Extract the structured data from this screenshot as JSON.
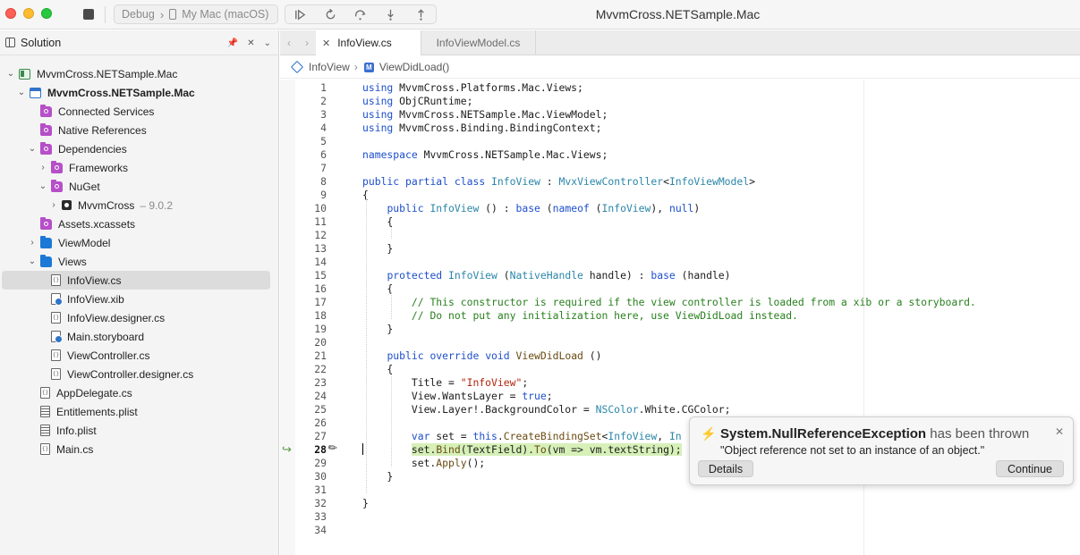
{
  "window": {
    "title": "MvvmCross.NETSample.Mac",
    "run_configuration": "Debug",
    "run_target": "My Mac (macOS)"
  },
  "toolbar": {
    "buttons": [
      "stop",
      "continue-debug",
      "restart",
      "step-over",
      "step-into",
      "step-out"
    ]
  },
  "sidebar": {
    "title": "Solution",
    "items": [
      {
        "label": "MvvmCross.NETSample.Mac",
        "icon": "solution-icon",
        "depth": 0,
        "expanded": true
      },
      {
        "label": "MvvmCross.NETSample.Mac",
        "icon": "project-icon",
        "depth": 1,
        "expanded": true,
        "bold": true
      },
      {
        "label": "Connected Services",
        "icon": "folder-purple-icon",
        "depth": 2
      },
      {
        "label": "Native References",
        "icon": "folder-purple-icon",
        "depth": 2
      },
      {
        "label": "Dependencies",
        "icon": "folder-purple-icon",
        "depth": 2,
        "expanded": true
      },
      {
        "label": "Frameworks",
        "icon": "folder-purple-icon",
        "depth": 3,
        "expanded": false
      },
      {
        "label": "NuGet",
        "icon": "folder-purple-icon",
        "depth": 3,
        "expanded": true
      },
      {
        "label": "MvvmCross",
        "version": "– 9.0.2",
        "icon": "package-icon",
        "depth": 4,
        "expanded": false
      },
      {
        "label": "Assets.xcassets",
        "icon": "folder-purple-icon",
        "depth": 2
      },
      {
        "label": "ViewModel",
        "icon": "folder-blue-icon",
        "depth": 2,
        "expanded": false
      },
      {
        "label": "Views",
        "icon": "folder-blue-icon",
        "depth": 2,
        "expanded": true
      },
      {
        "label": "InfoView.cs",
        "icon": "csharp-file-icon",
        "depth": 3,
        "selected": true
      },
      {
        "label": "InfoView.xib",
        "icon": "xib-file-icon",
        "depth": 3
      },
      {
        "label": "InfoView.designer.cs",
        "icon": "csharp-file-icon",
        "depth": 3
      },
      {
        "label": "Main.storyboard",
        "icon": "xib-file-icon",
        "depth": 3
      },
      {
        "label": "ViewController.cs",
        "icon": "csharp-file-icon",
        "depth": 3
      },
      {
        "label": "ViewController.designer.cs",
        "icon": "csharp-file-icon",
        "depth": 3
      },
      {
        "label": "AppDelegate.cs",
        "icon": "csharp-file-icon",
        "depth": 2
      },
      {
        "label": "Entitlements.plist",
        "icon": "plist-file-icon",
        "depth": 2
      },
      {
        "label": "Info.plist",
        "icon": "plist-file-icon",
        "depth": 2
      },
      {
        "label": "Main.cs",
        "icon": "csharp-file-icon",
        "depth": 2
      }
    ]
  },
  "tabs": [
    {
      "label": "InfoView.cs",
      "active": true
    },
    {
      "label": "InfoViewModel.cs",
      "active": false
    }
  ],
  "breadcrumb": {
    "class_name": "InfoView",
    "separator": "›",
    "method_name": "ViewDidLoad()"
  },
  "editor": {
    "current_line": 28,
    "lines": [
      "using MvvmCross.Platforms.Mac.Views;",
      "using ObjCRuntime;",
      "using MvvmCross.NETSample.Mac.ViewModel;",
      "using MvvmCross.Binding.BindingContext;",
      "",
      "namespace MvvmCross.NETSample.Mac.Views;",
      "",
      "public partial class InfoView : MvxViewController<InfoViewModel>",
      "{",
      "    public InfoView () : base (nameof (InfoView), null)",
      "    {",
      "",
      "    }",
      "",
      "    protected InfoView (NativeHandle handle) : base (handle)",
      "    {",
      "        // This constructor is required if the view controller is loaded from a xib or a storyboard.",
      "        // Do not put any initialization here, use ViewDidLoad instead.",
      "    }",
      "",
      "    public override void ViewDidLoad ()",
      "    {",
      "        Title = \"InfoView\";",
      "        View.WantsLayer = true;",
      "        View.Layer!.BackgroundColor = NSColor.White.CGColor;",
      "",
      "        var set = this.CreateBindingSet<InfoView, In",
      "        set.Bind(TextField).To(vm => vm.textString);",
      "        set.Apply();",
      "    }",
      "",
      "}",
      "",
      ""
    ]
  },
  "exception": {
    "type": "System.NullReferenceException",
    "suffix": " has been thrown",
    "message": "\"Object reference not set to an instance of an object.\"",
    "details_label": "Details",
    "continue_label": "Continue"
  },
  "colors": {
    "keyword": "#1d4fcc",
    "type": "#2b86a8",
    "string": "#b1250c",
    "comment": "#29801e",
    "current_line_highlight": "#d6f0b8",
    "exception_accent": "#f07c1a"
  }
}
